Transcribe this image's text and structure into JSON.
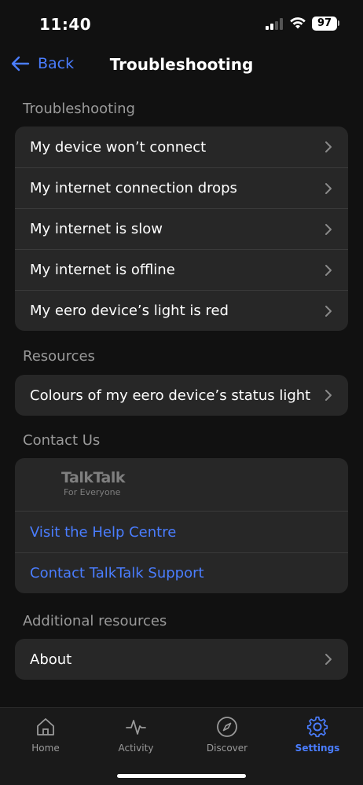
{
  "status": {
    "time": "11:40",
    "battery": "97"
  },
  "nav": {
    "back_label": "Back",
    "title": "Troubleshooting"
  },
  "sections": {
    "troubleshooting": {
      "label": "Troubleshooting",
      "items": [
        "My device won’t connect",
        "My internet connection drops",
        "My internet is slow",
        "My internet is offline",
        "My eero device’s light is red"
      ]
    },
    "resources": {
      "label": "Resources",
      "items": [
        "Colours of my eero device’s status light"
      ]
    },
    "contact": {
      "label": "Contact Us",
      "logo_main": "TalkTalk",
      "logo_sub": "For Everyone",
      "links": [
        "Visit the Help Centre",
        "Contact TalkTalk Support"
      ]
    },
    "additional": {
      "label": "Additional resources",
      "items": [
        "About"
      ]
    }
  },
  "tabs": [
    {
      "label": "Home",
      "icon": "home-icon"
    },
    {
      "label": "Activity",
      "icon": "activity-icon"
    },
    {
      "label": "Discover",
      "icon": "compass-icon"
    },
    {
      "label": "Settings",
      "icon": "gear-icon"
    }
  ],
  "colors": {
    "accent": "#4a7dff",
    "background": "#111111",
    "card": "#272727"
  }
}
